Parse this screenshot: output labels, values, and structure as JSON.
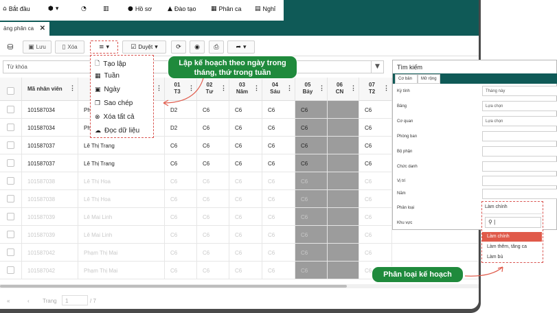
{
  "menubar": {
    "items": [
      {
        "icon": "home-icon",
        "label": "Bắt đầu"
      },
      {
        "icon": "cube-icon",
        "label": ""
      },
      {
        "icon": "dashboard-icon",
        "label": ""
      },
      {
        "icon": "bar-chart-icon",
        "label": ""
      },
      {
        "icon": "user-icon",
        "label": "Hồ sơ"
      },
      {
        "icon": "graduation-cap-icon",
        "label": "Đào tạo"
      },
      {
        "icon": "calendar-icon",
        "label": "Phân ca"
      },
      {
        "icon": "calendar-off-icon",
        "label": "Nghỉ"
      }
    ]
  },
  "tab": {
    "label": "ảng phân ca"
  },
  "toolbar": {
    "save_label": "Lưu",
    "delete_label": "Xóa",
    "approve_label": "Duyệt"
  },
  "search": {
    "placeholder": "Từ khóa"
  },
  "menu": {
    "items": [
      "Tạo lập",
      "Tuần",
      "Ngày",
      "Sao chép",
      "Xóa tất cả",
      "Đọc dữ liệu"
    ]
  },
  "callouts": {
    "plan": "Lập kế hoạch theo ngày trong tháng, thứ trong tuần",
    "category": "Phân loại kế hoạch"
  },
  "grid": {
    "columns": [
      {
        "day": "",
        "dow": "Mã nhân viên"
      },
      {
        "day": "01",
        "dow": "T3"
      },
      {
        "day": "02",
        "dow": "Tư"
      },
      {
        "day": "03",
        "dow": "Năm"
      },
      {
        "day": "04",
        "dow": "Sáu"
      },
      {
        "day": "05",
        "dow": "Bảy"
      },
      {
        "day": "06",
        "dow": "CN"
      },
      {
        "day": "07",
        "dow": "T2"
      }
    ],
    "rows": [
      {
        "id": "101587034",
        "name": "Ph",
        "shifts": [
          "D2",
          "C6",
          "C6",
          "C6",
          "C6",
          "",
          "C6"
        ]
      },
      {
        "id": "101587034",
        "name": "Ph",
        "shifts": [
          "D2",
          "C6",
          "C6",
          "C6",
          "C6",
          "",
          "C6"
        ]
      },
      {
        "id": "101587037",
        "name": "Lê Thị Trang",
        "shifts": [
          "C6",
          "C6",
          "C6",
          "C6",
          "C6",
          "",
          "C6"
        ]
      },
      {
        "id": "101587037",
        "name": "Lê Thị Trang",
        "shifts": [
          "C6",
          "C6",
          "C6",
          "C6",
          "C6",
          "",
          "C6"
        ]
      },
      {
        "id": "101587038",
        "name": "Lê Thị Hoa",
        "shifts": [
          "C6",
          "C6",
          "C6",
          "C6",
          "C6",
          "",
          "C6"
        ]
      },
      {
        "id": "101587038",
        "name": "Lê Thị Hoa",
        "shifts": [
          "C6",
          "C6",
          "C6",
          "C6",
          "C6",
          "",
          "C6"
        ]
      },
      {
        "id": "101587039",
        "name": "Lê Mai Linh",
        "shifts": [
          "C6",
          "C6",
          "C6",
          "C6",
          "C6",
          "",
          "C6"
        ]
      },
      {
        "id": "101587039",
        "name": "Lê Mai Linh",
        "shifts": [
          "C6",
          "C6",
          "C6",
          "C6",
          "C6",
          "",
          "C6"
        ]
      },
      {
        "id": "101587042",
        "name": "Phạm Thị Mai",
        "shifts": [
          "C6",
          "C6",
          "C6",
          "C6",
          "C6",
          "",
          "C6"
        ]
      },
      {
        "id": "101587042",
        "name": "Phạm Thị Mai",
        "shifts": [
          "C6",
          "C6",
          "C6",
          "C6",
          "C6",
          "",
          "C6"
        ]
      }
    ]
  },
  "footer": {
    "page_label": "Trang",
    "page_value": "1",
    "total": "/ 7"
  },
  "panel": {
    "title": "Tìm kiếm",
    "tabs": [
      "Cơ bản",
      "Mở rộng"
    ],
    "fields": [
      {
        "label": "Kỳ tính",
        "value": "Tháng này"
      },
      {
        "label": "Bảng",
        "value": "Lựa chọn"
      },
      {
        "label": "Cơ quan",
        "value": "Lựa chọn"
      },
      {
        "label": "Phòng ban",
        "value": ""
      },
      {
        "label": "Bộ phận",
        "value": ""
      },
      {
        "label": "Chức danh",
        "value": ""
      },
      {
        "label": "Vị trí",
        "value": ""
      },
      {
        "label": "Năm",
        "value": ""
      },
      {
        "label": "Phân loại",
        "value": ""
      },
      {
        "label": "Khu vực",
        "value": ""
      }
    ]
  },
  "classify_dropdown": {
    "selected": "Làm chính",
    "search_value": "|",
    "options": [
      "Làm chính",
      "Làm thêm, tăng ca",
      "Làm bù"
    ]
  },
  "colors": {
    "teal": "#0f5a57",
    "callout_green": "#1f8a3c",
    "highlight_red": "#e05a4a",
    "weekend_gray": "#9c9c9c"
  }
}
